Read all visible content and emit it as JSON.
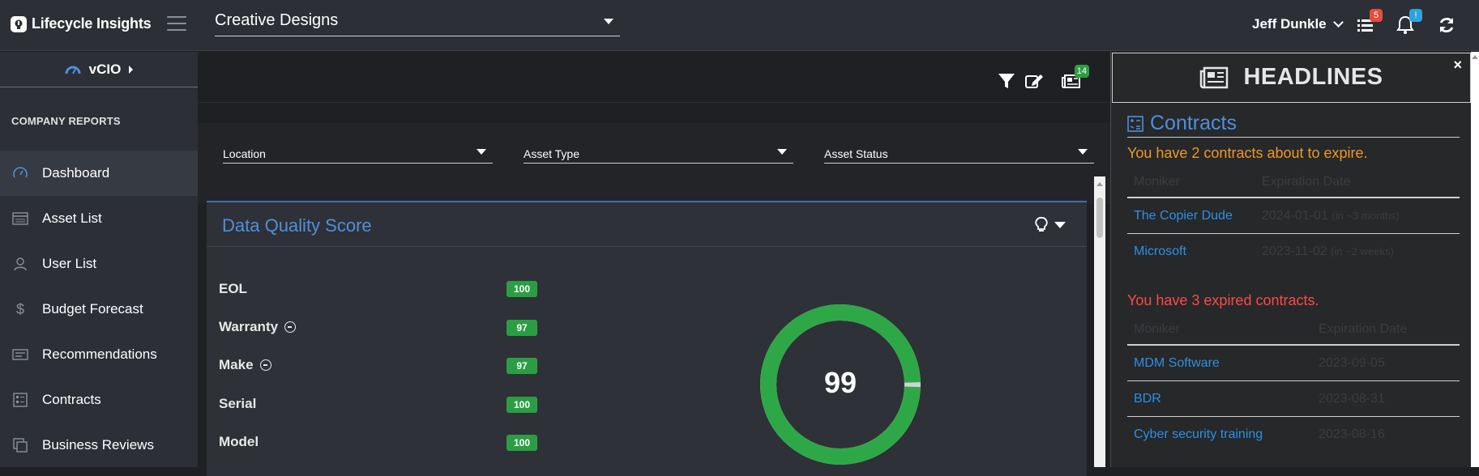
{
  "app": {
    "name": "Lifecycle Insights"
  },
  "header": {
    "company": "Creative Designs",
    "user_name": "Jeff Dunkle",
    "tasks_badge": "5",
    "alerts_badge": "!",
    "colors": {
      "tasks_badge": "#e74c3c",
      "alerts_badge": "#2ea3d9"
    }
  },
  "sidebar": {
    "switcher": "vCIO",
    "section": "COMPANY REPORTS",
    "items": [
      {
        "label": "Dashboard",
        "icon": "gauge-icon",
        "active": true
      },
      {
        "label": "Asset List",
        "icon": "list-icon"
      },
      {
        "label": "User List",
        "icon": "user-icon"
      },
      {
        "label": "Budget Forecast",
        "icon": "dollar-icon"
      },
      {
        "label": "Recommendations",
        "icon": "recommendations-icon"
      },
      {
        "label": "Contracts",
        "icon": "contracts-icon"
      },
      {
        "label": "Business Reviews",
        "icon": "copy-icon"
      }
    ]
  },
  "toolbar": {
    "headlines_badge": "14"
  },
  "filters": {
    "location": "Location",
    "asset_type": "Asset Type",
    "asset_status": "Asset Status"
  },
  "quality": {
    "title": "Data Quality Score",
    "score": "99",
    "score_fraction": 0.99,
    "rows": [
      {
        "label": "EOL",
        "value": "100"
      },
      {
        "label": "Warranty",
        "value": "97",
        "expandable": true
      },
      {
        "label": "Make",
        "value": "97",
        "expandable": true
      },
      {
        "label": "Serial",
        "value": "100"
      },
      {
        "label": "Model",
        "value": "100"
      }
    ]
  },
  "headlines": {
    "title": "HEADLINES",
    "close": "×",
    "contracts_title": "Contracts",
    "expiring_note": "You have 2 contracts about to expire.",
    "expired_note": "You have 3 expired contracts.",
    "col_moniker": "Moniker",
    "col_expiration": "Expiration Date",
    "expiring": [
      {
        "name": "The Copier Dude",
        "date": "2024-01-01",
        "rel": "(in ~3 months)"
      },
      {
        "name": "Microsoft",
        "date": "2023-11-02",
        "rel": "(in ~2 weeks)"
      }
    ],
    "expired": [
      {
        "name": "MDM Software",
        "date": "2023-09-05"
      },
      {
        "name": "BDR",
        "date": "2023-08-31"
      },
      {
        "name": "Cyber security training",
        "date": "2023-08-16"
      }
    ]
  }
}
